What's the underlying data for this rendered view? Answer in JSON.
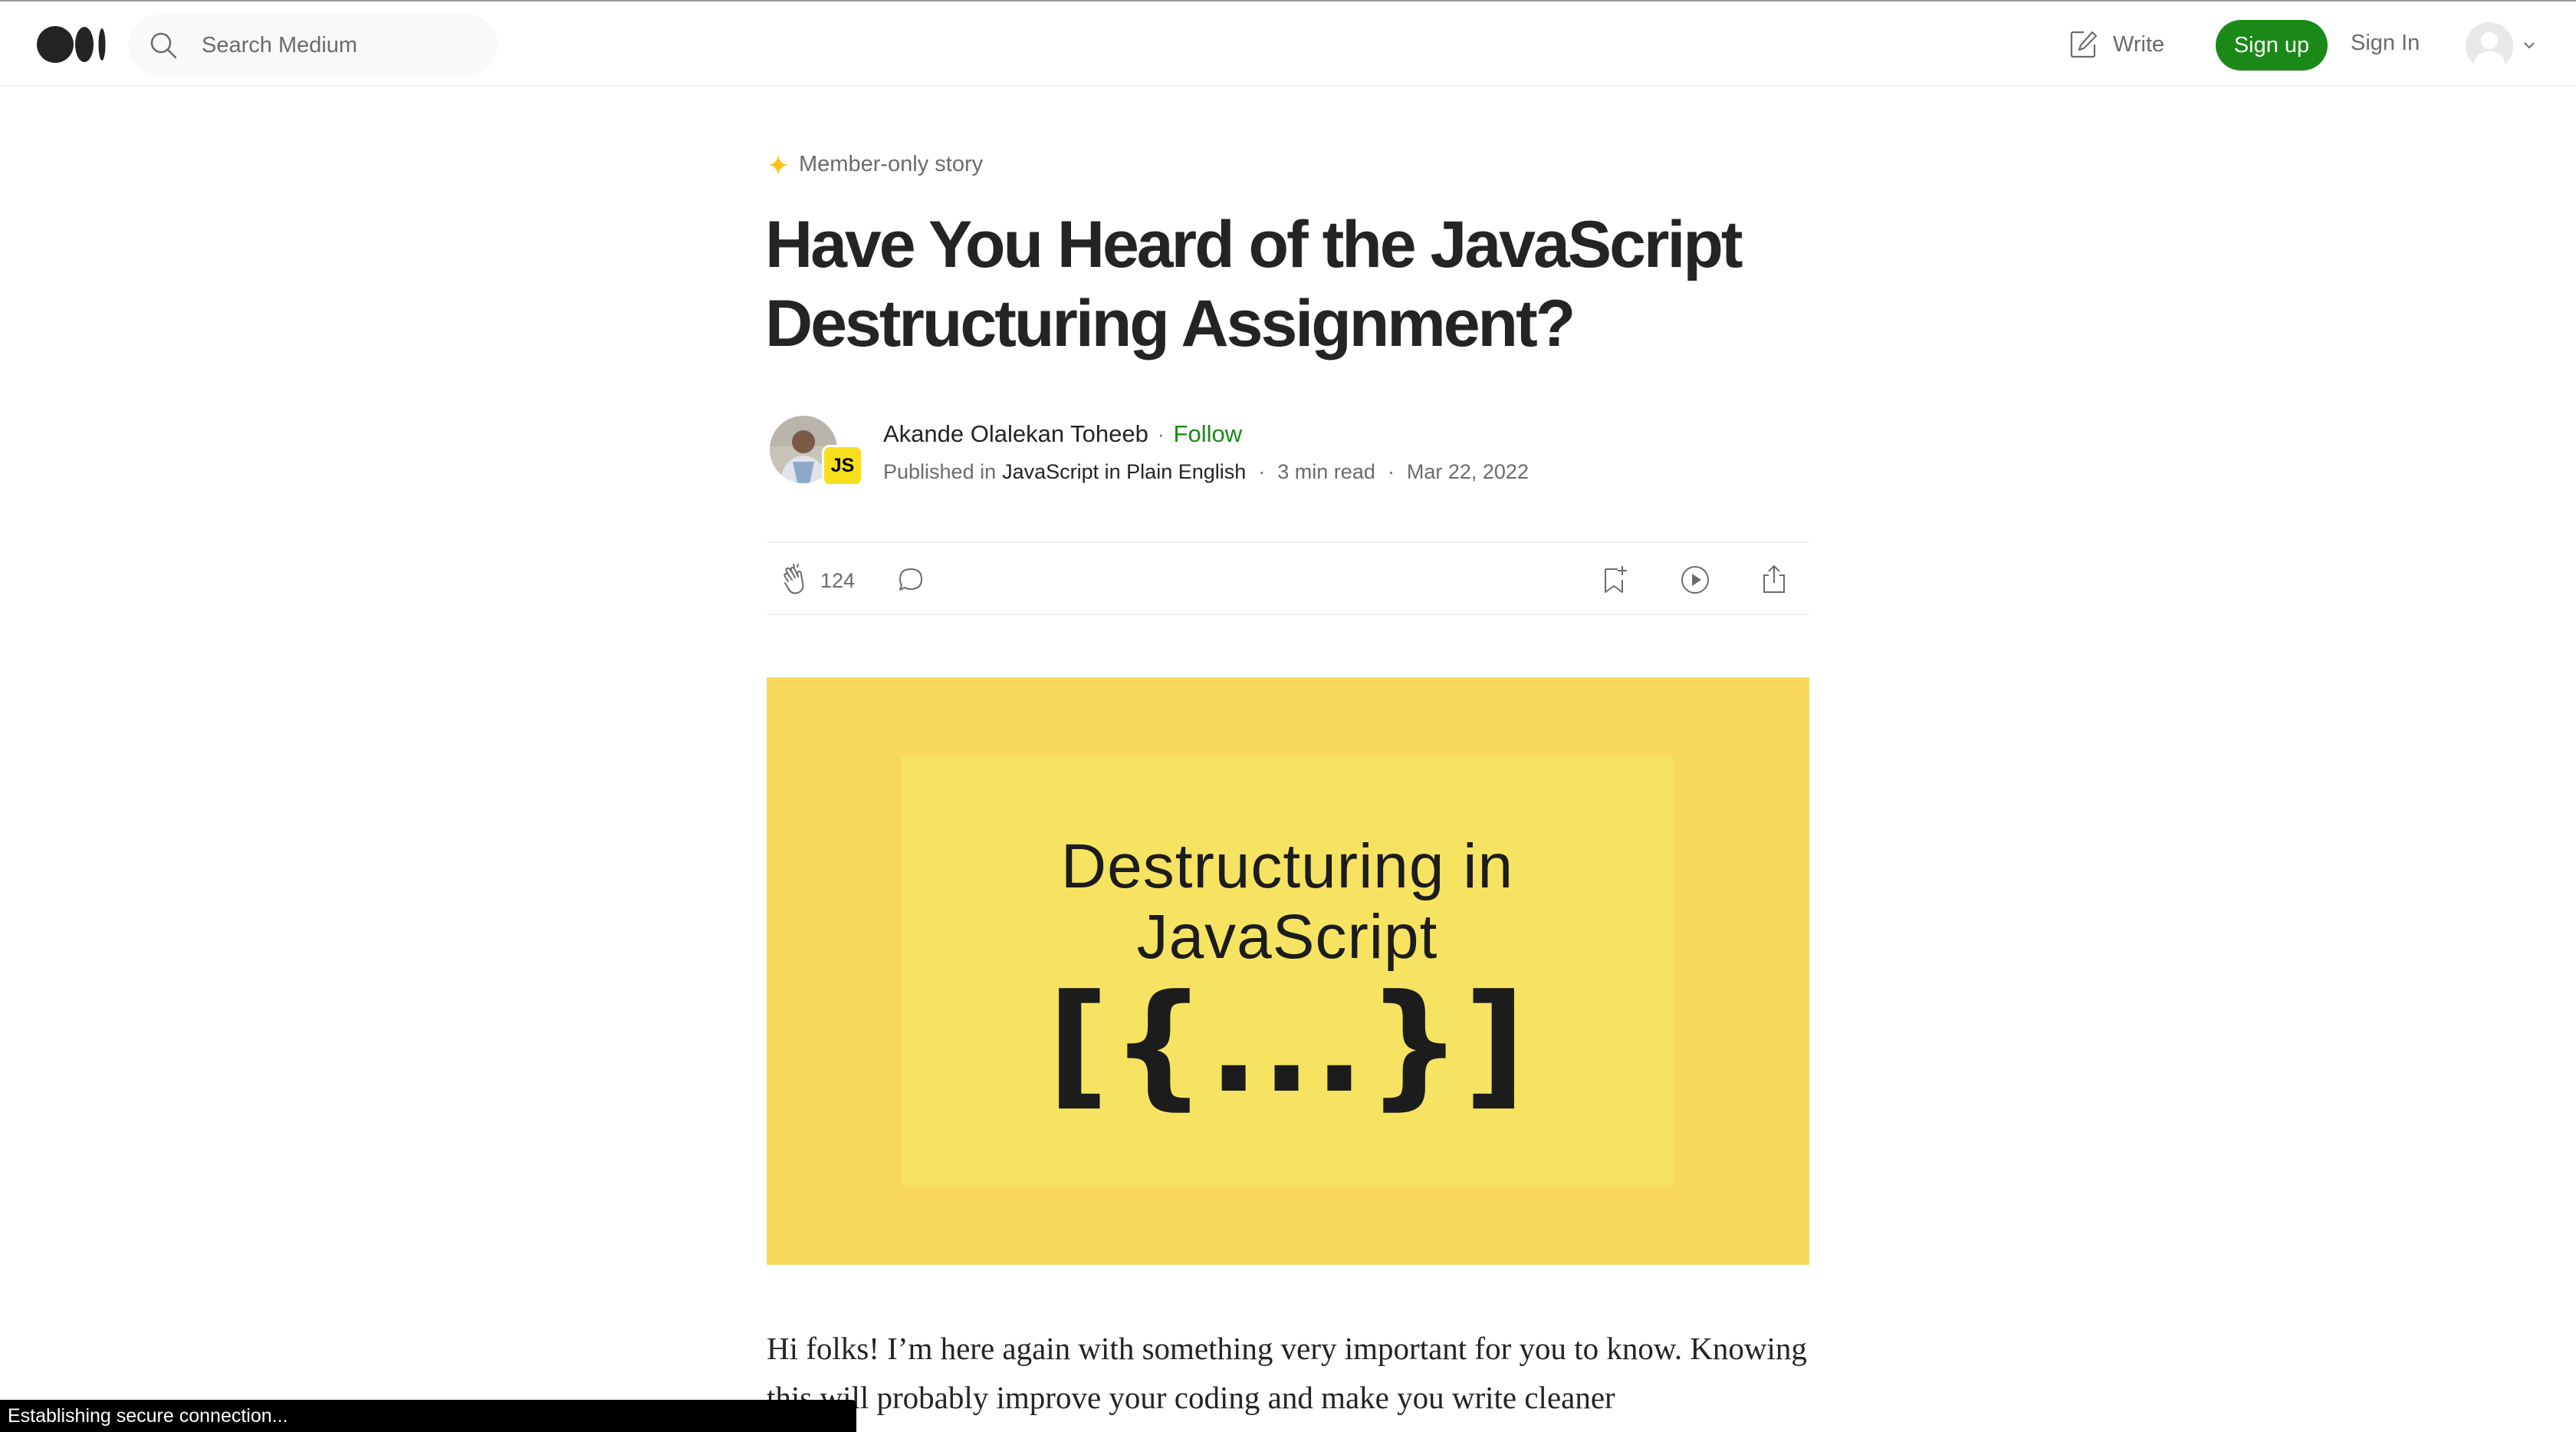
{
  "header": {
    "search_placeholder": "Search Medium",
    "write_label": "Write",
    "signup_label": "Sign up",
    "signin_label": "Sign In"
  },
  "article": {
    "member_label": "Member-only story",
    "title": "Have You Heard of the JavaScript Destructuring Assignment?",
    "author": "Akande Olalekan Toheeb",
    "follow_label": "Follow",
    "published_in_label": "Published in",
    "publication": "JavaScript in Plain English",
    "publication_badge": "JS",
    "read_time": "3 min read",
    "date": "Mar 22, 2022",
    "claps": "124"
  },
  "hero_image": {
    "line1": "Destructuring in",
    "line2": "JavaScript",
    "code": "[{...}]"
  },
  "body": {
    "paragraph": "Hi folks! I’m here again with something very important for you to know. Knowing this will probably improve your coding and make you write cleaner"
  },
  "status_bar": {
    "text": "Establishing secure connection..."
  },
  "colors": {
    "brand_green": "#1a8917",
    "hero_background": "#f8d95c",
    "member_star": "#ffc017"
  },
  "icons": {
    "logo": "medium-logo",
    "search": "search-icon",
    "write": "write-icon",
    "member": "star-icon",
    "clap": "clap-icon",
    "comment": "comment-icon",
    "bookmark": "bookmark-add-icon",
    "listen": "play-icon",
    "share": "share-icon"
  }
}
